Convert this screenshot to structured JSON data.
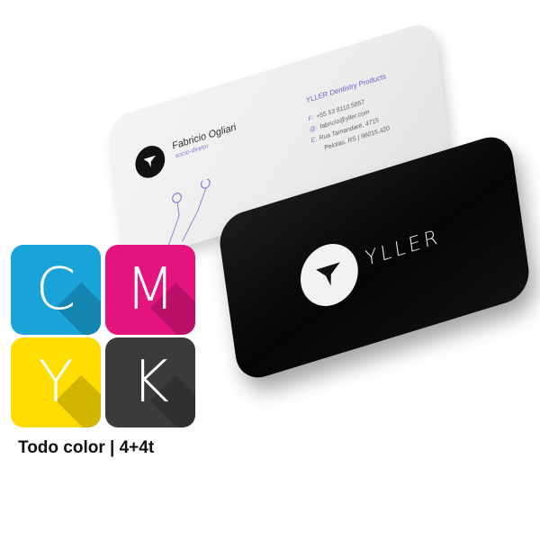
{
  "white_card": {
    "name": "Fabricio Ogliari",
    "role": "socio-diretor",
    "company": "YLLER Dentistry Products",
    "lines": [
      {
        "tag": "F:",
        "text": "+55 53 8110.5857"
      },
      {
        "tag": "@:",
        "text": "fabricio@yller.com"
      },
      {
        "tag": "E:",
        "text": "Rua Tamandaré, 4715"
      },
      {
        "tag": "",
        "text": "Pelotas, RS | 96015.420"
      }
    ]
  },
  "black_card": {
    "brand": "YLLER"
  },
  "cmyk": {
    "tiles": [
      {
        "letter": "C",
        "color": "#19a3d8"
      },
      {
        "letter": "M",
        "color": "#e3147e"
      },
      {
        "letter": "Y",
        "color": "#ffdd00"
      },
      {
        "letter": "K",
        "color": "#3b3b3d"
      }
    ]
  },
  "caption": "Todo color | 4+4t"
}
